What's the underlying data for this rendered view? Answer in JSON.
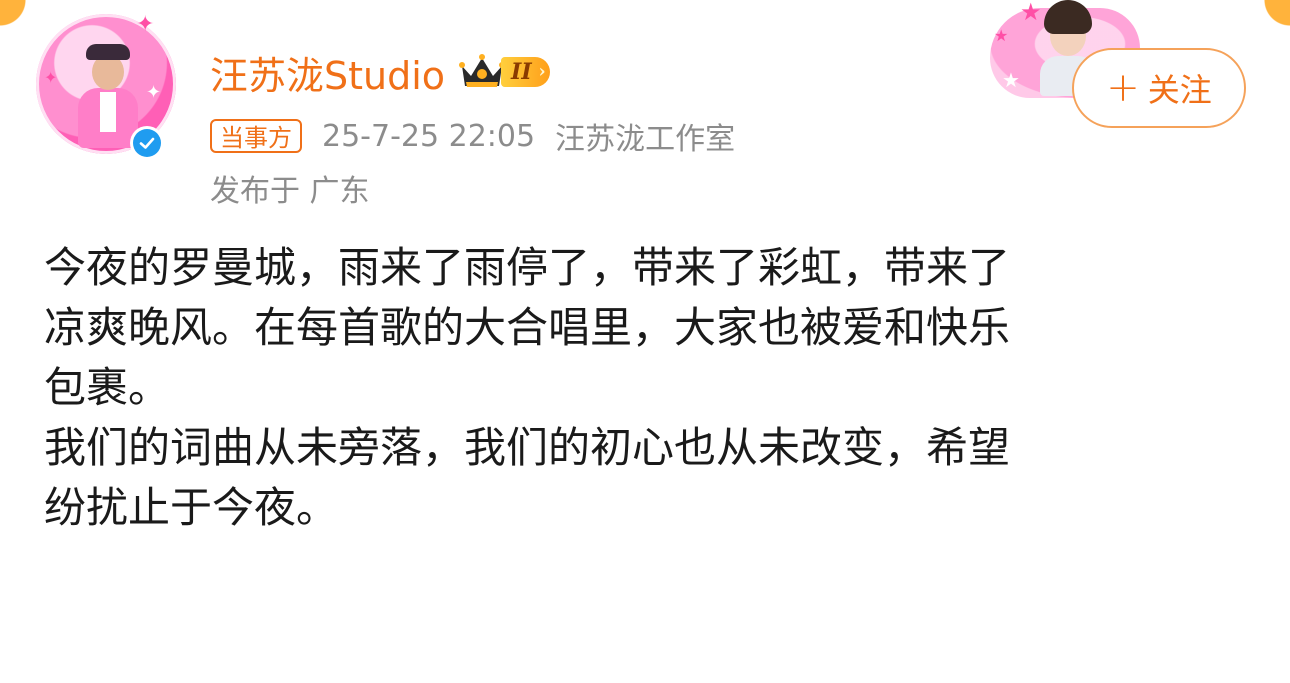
{
  "post": {
    "author": {
      "name": "汪苏泷Studio",
      "vip_level": "II",
      "verified": true
    },
    "tag": "当事方",
    "timestamp": "25-7-25 22:05",
    "source": "汪苏泷工作室",
    "location": "发布于 广东",
    "follow_label": "关注",
    "follow_plus": "+",
    "body_lines": [
      "今夜的罗曼城，雨来了雨停了，带来了彩虹，带来了",
      "凉爽晚风。在每首歌的大合唱里，大家也被爱和快乐",
      "包裹。",
      "我们的词曲从未旁落，我们的初心也从未改变，希望",
      "纷扰止于今夜。"
    ]
  },
  "colors": {
    "accent": "#f07018",
    "meta_text": "#8c8c8c",
    "body_text": "#1a1a1a",
    "verified": "#1f9cf0",
    "vip_gold": "#ffb020"
  },
  "icons": {
    "verified": "verified-check-icon",
    "crown": "crown-icon",
    "chevron": "chevron-right-icon"
  }
}
